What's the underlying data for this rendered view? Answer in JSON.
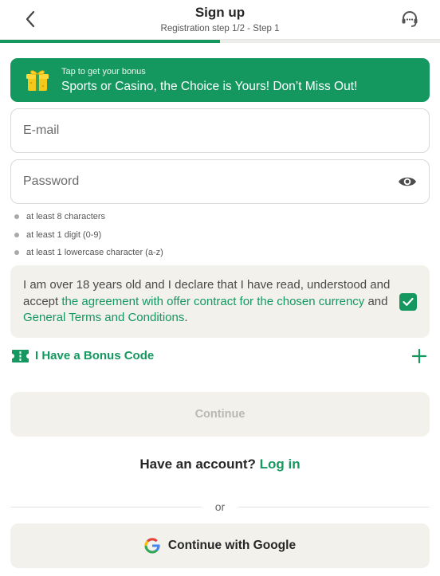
{
  "header": {
    "title": "Sign up",
    "subtitle": "Registration step 1/2 - Step 1",
    "progress": 0.5
  },
  "banner": {
    "small": "Tap to get your bonus",
    "main": "Sports or Casino, the Choice is Yours! Don’t Miss Out!"
  },
  "form": {
    "email_placeholder": "E-mail",
    "password_placeholder": "Password",
    "rules": [
      "at least 8 characters",
      "at least 1 digit (0-9)",
      "at least 1 lowercase character (a-z)"
    ]
  },
  "agreement": {
    "text_1": "I am over 18 years old and I declare that I have read, understood and accept ",
    "link_1": "the agreement with offer contract for the chosen currency",
    "text_2": " and ",
    "link_2": "General Terms and Conditions",
    "text_3": ".",
    "checked": true
  },
  "bonus_code": {
    "label": "I Have a Bonus Code"
  },
  "continue_label": "Continue",
  "account": {
    "question": "Have an account?",
    "login": "Log in"
  },
  "or_label": "or",
  "google_label": "Continue with Google",
  "colors": {
    "accent": "#14985f",
    "surface": "#f2f1ec",
    "disabled_text": "#b9b9b3"
  },
  "icons": [
    "back-arrow-icon",
    "support-headset-icon",
    "gift-icon",
    "eye-icon",
    "checkmark-icon",
    "ticket-icon",
    "plus-icon",
    "google-icon"
  ]
}
